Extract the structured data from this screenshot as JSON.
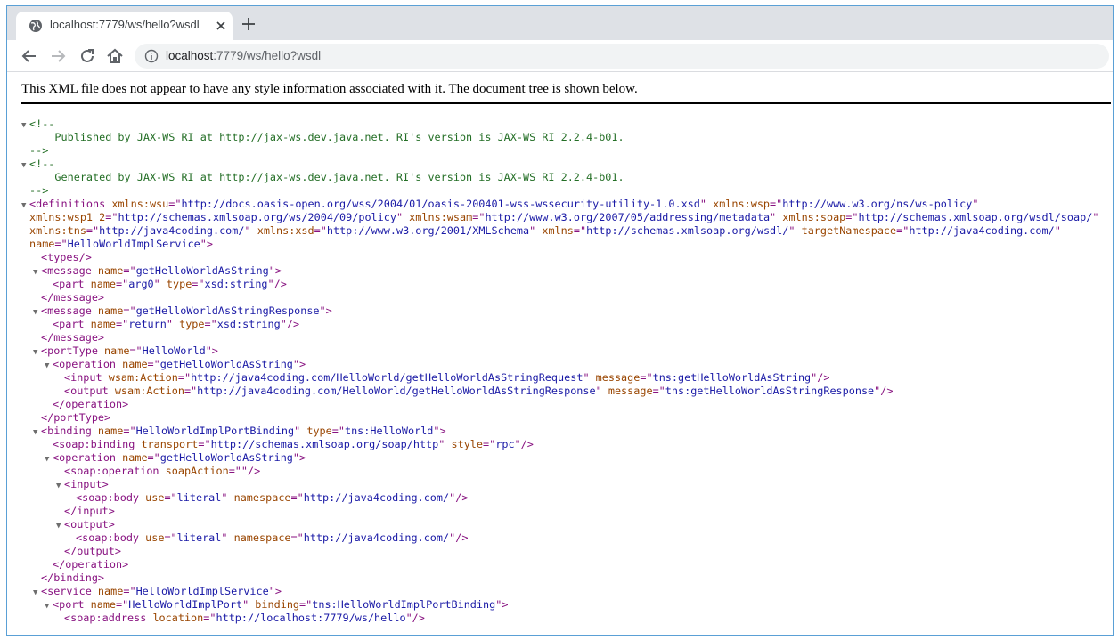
{
  "browser": {
    "tab_title": "localhost:7779/ws/hello?wsdl",
    "url_host": "localhost",
    "url_path": ":7779/ws/hello?wsdl"
  },
  "icons": [
    "globe-icon",
    "close-icon",
    "plus-icon",
    "back-arrow-icon",
    "forward-arrow-icon",
    "reload-icon",
    "home-icon",
    "info-icon",
    "collapse-triangle-icon"
  ],
  "notice": "This XML file does not appear to have any style information associated with it. The document tree is shown below.",
  "lines": [
    {
      "i": 0,
      "a": "▼",
      "p": [
        [
          "cm",
          "<!--"
        ]
      ]
    },
    {
      "i": 0,
      "a": "",
      "p": [
        [
          "cm",
          "    Published by JAX-WS RI at http://jax-ws.dev.java.net. RI's version is JAX-WS RI 2.2.4-b01.\n"
        ]
      ]
    },
    {
      "i": 0,
      "a": "",
      "p": [
        [
          "cm",
          "-->"
        ]
      ]
    },
    {
      "i": 0,
      "a": "▼",
      "p": [
        [
          "cm",
          "<!--"
        ]
      ]
    },
    {
      "i": 0,
      "a": "",
      "p": [
        [
          "cm",
          "    Generated by JAX-WS RI at http://jax-ws.dev.java.net. RI's version is JAX-WS RI 2.2.4-b01.\n"
        ]
      ]
    },
    {
      "i": 0,
      "a": "",
      "p": [
        [
          "cm",
          "-->"
        ]
      ]
    },
    {
      "i": 0,
      "a": "▼",
      "p": [
        [
          "tg",
          "<definitions"
        ],
        [
          "an",
          " xmlns:wsu"
        ],
        [
          "tg",
          "=\""
        ],
        [
          "av",
          "http://docs.oasis-open.org/wss/2004/01/oasis-200401-wss-wssecurity-utility-1.0.xsd"
        ],
        [
          "tg",
          "\""
        ],
        [
          "an",
          " xmlns:wsp"
        ],
        [
          "tg",
          "=\""
        ],
        [
          "av",
          "http://www.w3.org/ns/ws-policy"
        ],
        [
          "tg",
          "\""
        ]
      ]
    },
    {
      "i": 0,
      "a": "",
      "p": [
        [
          "an",
          "xmlns:wsp1_2"
        ],
        [
          "tg",
          "=\""
        ],
        [
          "av",
          "http://schemas.xmlsoap.org/ws/2004/09/policy"
        ],
        [
          "tg",
          "\""
        ],
        [
          "an",
          " xmlns:wsam"
        ],
        [
          "tg",
          "=\""
        ],
        [
          "av",
          "http://www.w3.org/2007/05/addressing/metadata"
        ],
        [
          "tg",
          "\""
        ],
        [
          "an",
          " xmlns:soap"
        ],
        [
          "tg",
          "=\""
        ],
        [
          "av",
          "http://schemas.xmlsoap.org/wsdl/soap/"
        ],
        [
          "tg",
          "\""
        ]
      ]
    },
    {
      "i": 0,
      "a": "",
      "p": [
        [
          "an",
          "xmlns:tns"
        ],
        [
          "tg",
          "=\""
        ],
        [
          "av",
          "http://java4coding.com/"
        ],
        [
          "tg",
          "\""
        ],
        [
          "an",
          " xmlns:xsd"
        ],
        [
          "tg",
          "=\""
        ],
        [
          "av",
          "http://www.w3.org/2001/XMLSchema"
        ],
        [
          "tg",
          "\""
        ],
        [
          "an",
          " xmlns"
        ],
        [
          "tg",
          "=\""
        ],
        [
          "av",
          "http://schemas.xmlsoap.org/wsdl/"
        ],
        [
          "tg",
          "\""
        ],
        [
          "an",
          " targetNamespace"
        ],
        [
          "tg",
          "=\""
        ],
        [
          "av",
          "http://java4coding.com/"
        ],
        [
          "tg",
          "\""
        ]
      ]
    },
    {
      "i": 0,
      "a": "",
      "p": [
        [
          "an",
          "name"
        ],
        [
          "tg",
          "=\""
        ],
        [
          "av",
          "HelloWorldImplService"
        ],
        [
          "tg",
          "\">"
        ]
      ]
    },
    {
      "i": 1,
      "a": "",
      "p": [
        [
          "tg",
          "<types/>"
        ]
      ]
    },
    {
      "i": 1,
      "a": "▼",
      "p": [
        [
          "tg",
          "<message"
        ],
        [
          "an",
          " name"
        ],
        [
          "tg",
          "=\""
        ],
        [
          "av",
          "getHelloWorldAsString"
        ],
        [
          "tg",
          "\">"
        ]
      ]
    },
    {
      "i": 2,
      "a": "",
      "p": [
        [
          "tg",
          "<part"
        ],
        [
          "an",
          " name"
        ],
        [
          "tg",
          "=\""
        ],
        [
          "av",
          "arg0"
        ],
        [
          "tg",
          "\""
        ],
        [
          "an",
          " type"
        ],
        [
          "tg",
          "=\""
        ],
        [
          "av",
          "xsd:string"
        ],
        [
          "tg",
          "\"/>"
        ]
      ]
    },
    {
      "i": 1,
      "a": "",
      "p": [
        [
          "tg",
          "</message>"
        ]
      ]
    },
    {
      "i": 1,
      "a": "▼",
      "p": [
        [
          "tg",
          "<message"
        ],
        [
          "an",
          " name"
        ],
        [
          "tg",
          "=\""
        ],
        [
          "av",
          "getHelloWorldAsStringResponse"
        ],
        [
          "tg",
          "\">"
        ]
      ]
    },
    {
      "i": 2,
      "a": "",
      "p": [
        [
          "tg",
          "<part"
        ],
        [
          "an",
          " name"
        ],
        [
          "tg",
          "=\""
        ],
        [
          "av",
          "return"
        ],
        [
          "tg",
          "\""
        ],
        [
          "an",
          " type"
        ],
        [
          "tg",
          "=\""
        ],
        [
          "av",
          "xsd:string"
        ],
        [
          "tg",
          "\"/>"
        ]
      ]
    },
    {
      "i": 1,
      "a": "",
      "p": [
        [
          "tg",
          "</message>"
        ]
      ]
    },
    {
      "i": 1,
      "a": "▼",
      "p": [
        [
          "tg",
          "<portType"
        ],
        [
          "an",
          " name"
        ],
        [
          "tg",
          "=\""
        ],
        [
          "av",
          "HelloWorld"
        ],
        [
          "tg",
          "\">"
        ]
      ]
    },
    {
      "i": 2,
      "a": "▼",
      "p": [
        [
          "tg",
          "<operation"
        ],
        [
          "an",
          " name"
        ],
        [
          "tg",
          "=\""
        ],
        [
          "av",
          "getHelloWorldAsString"
        ],
        [
          "tg",
          "\">"
        ]
      ]
    },
    {
      "i": 3,
      "a": "",
      "p": [
        [
          "tg",
          "<input"
        ],
        [
          "an",
          " wsam:Action"
        ],
        [
          "tg",
          "=\""
        ],
        [
          "av",
          "http://java4coding.com/HelloWorld/getHelloWorldAsStringRequest"
        ],
        [
          "tg",
          "\""
        ],
        [
          "an",
          " message"
        ],
        [
          "tg",
          "=\""
        ],
        [
          "av",
          "tns:getHelloWorldAsString"
        ],
        [
          "tg",
          "\"/>"
        ]
      ]
    },
    {
      "i": 3,
      "a": "",
      "p": [
        [
          "tg",
          "<output"
        ],
        [
          "an",
          " wsam:Action"
        ],
        [
          "tg",
          "=\""
        ],
        [
          "av",
          "http://java4coding.com/HelloWorld/getHelloWorldAsStringResponse"
        ],
        [
          "tg",
          "\""
        ],
        [
          "an",
          " message"
        ],
        [
          "tg",
          "=\""
        ],
        [
          "av",
          "tns:getHelloWorldAsStringResponse"
        ],
        [
          "tg",
          "\"/>"
        ]
      ]
    },
    {
      "i": 2,
      "a": "",
      "p": [
        [
          "tg",
          "</operation>"
        ]
      ]
    },
    {
      "i": 1,
      "a": "",
      "p": [
        [
          "tg",
          "</portType>"
        ]
      ]
    },
    {
      "i": 1,
      "a": "▼",
      "p": [
        [
          "tg",
          "<binding"
        ],
        [
          "an",
          " name"
        ],
        [
          "tg",
          "=\""
        ],
        [
          "av",
          "HelloWorldImplPortBinding"
        ],
        [
          "tg",
          "\""
        ],
        [
          "an",
          " type"
        ],
        [
          "tg",
          "=\""
        ],
        [
          "av",
          "tns:HelloWorld"
        ],
        [
          "tg",
          "\">"
        ]
      ]
    },
    {
      "i": 2,
      "a": "",
      "p": [
        [
          "tg",
          "<soap:binding"
        ],
        [
          "an",
          " transport"
        ],
        [
          "tg",
          "=\""
        ],
        [
          "av",
          "http://schemas.xmlsoap.org/soap/http"
        ],
        [
          "tg",
          "\""
        ],
        [
          "an",
          " style"
        ],
        [
          "tg",
          "=\""
        ],
        [
          "av",
          "rpc"
        ],
        [
          "tg",
          "\"/>"
        ]
      ]
    },
    {
      "i": 2,
      "a": "▼",
      "p": [
        [
          "tg",
          "<operation"
        ],
        [
          "an",
          " name"
        ],
        [
          "tg",
          "=\""
        ],
        [
          "av",
          "getHelloWorldAsString"
        ],
        [
          "tg",
          "\">"
        ]
      ]
    },
    {
      "i": 3,
      "a": "",
      "p": [
        [
          "tg",
          "<soap:operation"
        ],
        [
          "an",
          " soapAction"
        ],
        [
          "tg",
          "=\"\"/>"
        ]
      ]
    },
    {
      "i": 3,
      "a": "▼",
      "p": [
        [
          "tg",
          "<input>"
        ]
      ]
    },
    {
      "i": 4,
      "a": "",
      "p": [
        [
          "tg",
          "<soap:body"
        ],
        [
          "an",
          " use"
        ],
        [
          "tg",
          "=\""
        ],
        [
          "av",
          "literal"
        ],
        [
          "tg",
          "\""
        ],
        [
          "an",
          " namespace"
        ],
        [
          "tg",
          "=\""
        ],
        [
          "av",
          "http://java4coding.com/"
        ],
        [
          "tg",
          "\"/>"
        ]
      ]
    },
    {
      "i": 3,
      "a": "",
      "p": [
        [
          "tg",
          "</input>"
        ]
      ]
    },
    {
      "i": 3,
      "a": "▼",
      "p": [
        [
          "tg",
          "<output>"
        ]
      ]
    },
    {
      "i": 4,
      "a": "",
      "p": [
        [
          "tg",
          "<soap:body"
        ],
        [
          "an",
          " use"
        ],
        [
          "tg",
          "=\""
        ],
        [
          "av",
          "literal"
        ],
        [
          "tg",
          "\""
        ],
        [
          "an",
          " namespace"
        ],
        [
          "tg",
          "=\""
        ],
        [
          "av",
          "http://java4coding.com/"
        ],
        [
          "tg",
          "\"/>"
        ]
      ]
    },
    {
      "i": 3,
      "a": "",
      "p": [
        [
          "tg",
          "</output>"
        ]
      ]
    },
    {
      "i": 2,
      "a": "",
      "p": [
        [
          "tg",
          "</operation>"
        ]
      ]
    },
    {
      "i": 1,
      "a": "",
      "p": [
        [
          "tg",
          "</binding>"
        ]
      ]
    },
    {
      "i": 1,
      "a": "▼",
      "p": [
        [
          "tg",
          "<service"
        ],
        [
          "an",
          " name"
        ],
        [
          "tg",
          "=\""
        ],
        [
          "av",
          "HelloWorldImplService"
        ],
        [
          "tg",
          "\">"
        ]
      ]
    },
    {
      "i": 2,
      "a": "▼",
      "p": [
        [
          "tg",
          "<port"
        ],
        [
          "an",
          " name"
        ],
        [
          "tg",
          "=\""
        ],
        [
          "av",
          "HelloWorldImplPort"
        ],
        [
          "tg",
          "\""
        ],
        [
          "an",
          " binding"
        ],
        [
          "tg",
          "=\""
        ],
        [
          "av",
          "tns:HelloWorldImplPortBinding"
        ],
        [
          "tg",
          "\">"
        ]
      ]
    },
    {
      "i": 3,
      "a": "",
      "p": [
        [
          "tg",
          "<soap:address"
        ],
        [
          "an",
          " location"
        ],
        [
          "tg",
          "=\""
        ],
        [
          "av",
          "http://localhost:7779/ws/hello"
        ],
        [
          "tg",
          "\"/>"
        ]
      ]
    }
  ]
}
